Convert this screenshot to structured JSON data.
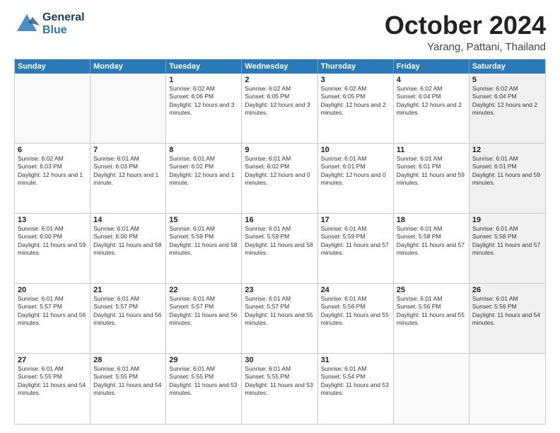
{
  "header": {
    "logo_general": "General",
    "logo_blue": "Blue",
    "month_title": "October 2024",
    "location": "Yarang, Pattani, Thailand"
  },
  "calendar": {
    "days_of_week": [
      "Sunday",
      "Monday",
      "Tuesday",
      "Wednesday",
      "Thursday",
      "Friday",
      "Saturday"
    ],
    "weeks": [
      [
        {
          "day": "",
          "empty": true
        },
        {
          "day": "",
          "empty": true
        },
        {
          "day": "1",
          "sunrise": "6:02 AM",
          "sunset": "6:06 PM",
          "daylight": "12 hours and 3 minutes."
        },
        {
          "day": "2",
          "sunrise": "6:02 AM",
          "sunset": "6:05 PM",
          "daylight": "12 hours and 3 minutes."
        },
        {
          "day": "3",
          "sunrise": "6:02 AM",
          "sunset": "6:05 PM",
          "daylight": "12 hours and 2 minutes."
        },
        {
          "day": "4",
          "sunrise": "6:02 AM",
          "sunset": "6:04 PM",
          "daylight": "12 hours and 2 minutes."
        },
        {
          "day": "5",
          "shaded": true,
          "sunrise": "6:02 AM",
          "sunset": "6:04 PM",
          "daylight": "12 hours and 2 minutes."
        }
      ],
      [
        {
          "day": "6",
          "sunrise": "6:02 AM",
          "sunset": "6:03 PM",
          "daylight": "12 hours and 1 minute."
        },
        {
          "day": "7",
          "sunrise": "6:01 AM",
          "sunset": "6:03 PM",
          "daylight": "12 hours and 1 minute."
        },
        {
          "day": "8",
          "sunrise": "6:01 AM",
          "sunset": "6:02 PM",
          "daylight": "12 hours and 1 minute."
        },
        {
          "day": "9",
          "sunrise": "6:01 AM",
          "sunset": "6:02 PM",
          "daylight": "12 hours and 0 minutes."
        },
        {
          "day": "10",
          "sunrise": "6:01 AM",
          "sunset": "6:01 PM",
          "daylight": "12 hours and 0 minutes."
        },
        {
          "day": "11",
          "sunrise": "6:01 AM",
          "sunset": "6:01 PM",
          "daylight": "11 hours and 59 minutes."
        },
        {
          "day": "12",
          "shaded": true,
          "sunrise": "6:01 AM",
          "sunset": "6:01 PM",
          "daylight": "11 hours and 59 minutes."
        }
      ],
      [
        {
          "day": "13",
          "sunrise": "6:01 AM",
          "sunset": "6:00 PM",
          "daylight": "11 hours and 59 minutes."
        },
        {
          "day": "14",
          "sunrise": "6:01 AM",
          "sunset": "6:00 PM",
          "daylight": "11 hours and 58 minutes."
        },
        {
          "day": "15",
          "sunrise": "6:01 AM",
          "sunset": "5:59 PM",
          "daylight": "11 hours and 58 minutes."
        },
        {
          "day": "16",
          "sunrise": "6:01 AM",
          "sunset": "5:59 PM",
          "daylight": "11 hours and 58 minutes."
        },
        {
          "day": "17",
          "sunrise": "6:01 AM",
          "sunset": "5:59 PM",
          "daylight": "11 hours and 57 minutes."
        },
        {
          "day": "18",
          "sunrise": "6:01 AM",
          "sunset": "5:58 PM",
          "daylight": "11 hours and 57 minutes."
        },
        {
          "day": "19",
          "shaded": true,
          "sunrise": "6:01 AM",
          "sunset": "5:58 PM",
          "daylight": "11 hours and 57 minutes."
        }
      ],
      [
        {
          "day": "20",
          "sunrise": "6:01 AM",
          "sunset": "5:57 PM",
          "daylight": "11 hours and 56 minutes."
        },
        {
          "day": "21",
          "sunrise": "6:01 AM",
          "sunset": "5:57 PM",
          "daylight": "11 hours and 56 minutes."
        },
        {
          "day": "22",
          "sunrise": "6:01 AM",
          "sunset": "5:57 PM",
          "daylight": "11 hours and 56 minutes."
        },
        {
          "day": "23",
          "sunrise": "6:01 AM",
          "sunset": "5:57 PM",
          "daylight": "11 hours and 55 minutes."
        },
        {
          "day": "24",
          "sunrise": "6:01 AM",
          "sunset": "5:56 PM",
          "daylight": "11 hours and 55 minutes."
        },
        {
          "day": "25",
          "sunrise": "6:01 AM",
          "sunset": "5:56 PM",
          "daylight": "11 hours and 55 minutes."
        },
        {
          "day": "26",
          "shaded": true,
          "sunrise": "6:01 AM",
          "sunset": "5:56 PM",
          "daylight": "11 hours and 54 minutes."
        }
      ],
      [
        {
          "day": "27",
          "sunrise": "6:01 AM",
          "sunset": "5:55 PM",
          "daylight": "11 hours and 54 minutes."
        },
        {
          "day": "28",
          "sunrise": "6:01 AM",
          "sunset": "5:55 PM",
          "daylight": "11 hours and 54 minutes."
        },
        {
          "day": "29",
          "sunrise": "6:01 AM",
          "sunset": "5:55 PM",
          "daylight": "11 hours and 53 minutes."
        },
        {
          "day": "30",
          "sunrise": "6:01 AM",
          "sunset": "5:55 PM",
          "daylight": "11 hours and 53 minutes."
        },
        {
          "day": "31",
          "sunrise": "6:01 AM",
          "sunset": "5:54 PM",
          "daylight": "11 hours and 53 minutes."
        },
        {
          "day": "",
          "empty": true
        },
        {
          "day": "",
          "empty": true
        }
      ]
    ]
  }
}
